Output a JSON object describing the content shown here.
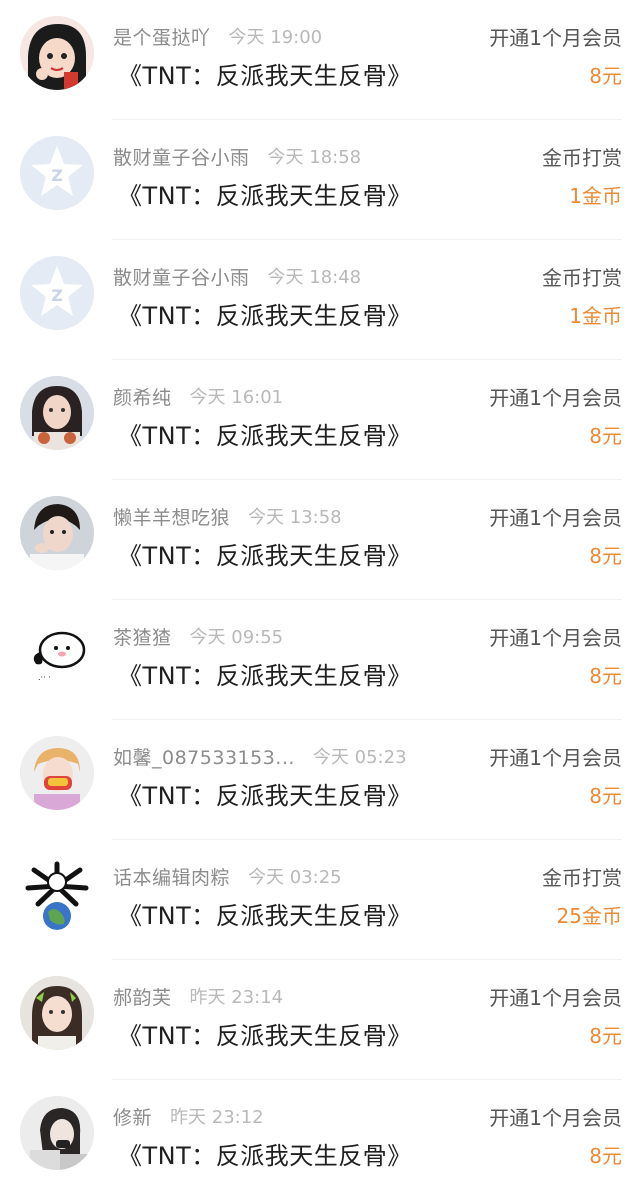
{
  "records": [
    {
      "user": "是个蛋挞吖",
      "time": "今天 19:00",
      "title": "《TNT：反派我天生反骨》",
      "action": "开通1个月会员",
      "amount": "8元",
      "avatar": "cartoon-girl"
    },
    {
      "user": "散财童子谷小雨",
      "time": "今天 18:58",
      "title": "《TNT：反派我天生反骨》",
      "action": "金币打赏",
      "amount": "1金币",
      "avatar": "default-star"
    },
    {
      "user": "散财童子谷小雨",
      "time": "今天 18:48",
      "title": "《TNT：反派我天生反骨》",
      "action": "金币打赏",
      "amount": "1金币",
      "avatar": "default-star"
    },
    {
      "user": "颜希纯",
      "time": "今天 16:01",
      "title": "《TNT：反派我天生反骨》",
      "action": "开通1个月会员",
      "amount": "8元",
      "avatar": "photo-girl"
    },
    {
      "user": "懒羊羊想吃狼",
      "time": "今天 13:58",
      "title": "《TNT：反派我天生反骨》",
      "action": "开通1个月会员",
      "amount": "8元",
      "avatar": "photo-boy"
    },
    {
      "user": "茶猹猹",
      "time": "今天 09:55",
      "title": "《TNT：反派我天生反骨》",
      "action": "开通1个月会员",
      "amount": "8元",
      "avatar": "cartoon-blob"
    },
    {
      "user": "如馨_087533153...",
      "time": "今天 05:23",
      "title": "《TNT：反派我天生反骨》",
      "action": "开通1个月会员",
      "amount": "8元",
      "avatar": "photo-kid"
    },
    {
      "user": "话本编辑肉粽",
      "time": "今天 03:25",
      "title": "《TNT：反派我天生反骨》",
      "action": "金币打赏",
      "amount": "25金币",
      "avatar": "cartoon-earth"
    },
    {
      "user": "郝韵芙",
      "time": "昨天 23:14",
      "title": "《TNT：反派我天生反骨》",
      "action": "开通1个月会员",
      "amount": "8元",
      "avatar": "photo-girl-2"
    },
    {
      "user": "修新",
      "time": "昨天 23:12",
      "title": "《TNT：反派我天生反骨》",
      "action": "开通1个月会员",
      "amount": "8元",
      "avatar": "photo-girl-3"
    }
  ],
  "colors": {
    "amount": "#ec8a35",
    "username": "#8c8c8c",
    "time": "#b9b9b9",
    "title": "#202020",
    "action": "#555555"
  }
}
